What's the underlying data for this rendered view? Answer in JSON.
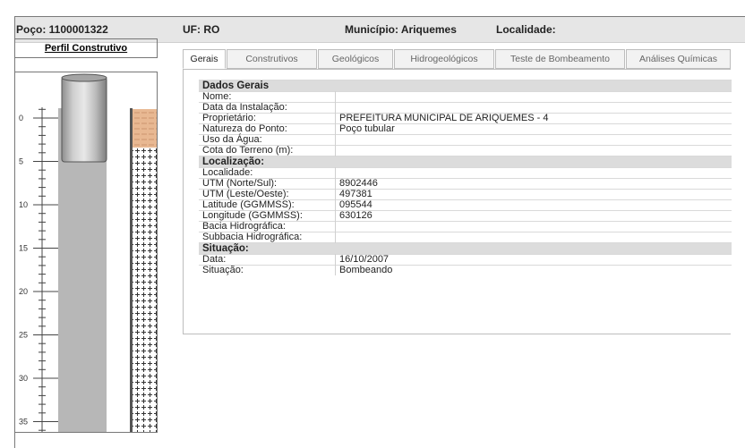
{
  "header": {
    "poco": "Poço: 1100001322",
    "uf": "UF: RO",
    "municipio": "Município: Ariquemes",
    "localidade": "Localidade:"
  },
  "left_panel": {
    "title": "Perfil Construtivo",
    "depth_labels": [
      "0",
      "5",
      "10",
      "15",
      "20",
      "25",
      "30",
      "35"
    ]
  },
  "tabs": [
    {
      "label": "Gerais",
      "active": true
    },
    {
      "label": "Construtivos",
      "active": false
    },
    {
      "label": "Geológicos",
      "active": false
    },
    {
      "label": "Hidrogeológicos",
      "active": false
    },
    {
      "label": "Teste de Bombeamento",
      "active": false
    },
    {
      "label": "Análises Químicas",
      "active": false
    }
  ],
  "sections": [
    {
      "title": "Dados Gerais",
      "rows": [
        {
          "label": "Nome:",
          "value": ""
        },
        {
          "label": "Data da Instalação:",
          "value": ""
        },
        {
          "label": "Proprietário:",
          "value": "PREFEITURA MUNICIPAL DE ARIQUEMES - 4"
        },
        {
          "label": "Natureza do Ponto:",
          "value": "Poço tubular"
        },
        {
          "label": "Uso da Água:",
          "value": ""
        },
        {
          "label": "Cota do Terreno (m):",
          "value": ""
        }
      ]
    },
    {
      "title": "Localização:",
      "rows": [
        {
          "label": "Localidade:",
          "value": ""
        },
        {
          "label": "UTM (Norte/Sul):",
          "value": "8902446"
        },
        {
          "label": "UTM (Leste/Oeste):",
          "value": "497381"
        },
        {
          "label": "Latitude (GGMMSS):",
          "value": "095544"
        },
        {
          "label": "Longitude (GGMMSS):",
          "value": "630126"
        },
        {
          "label": "Bacia Hidrográfica:",
          "value": ""
        },
        {
          "label": "Subbacia Hidrográfica:",
          "value": ""
        }
      ]
    },
    {
      "title": "Situação:",
      "rows": [
        {
          "label": "Data:",
          "value": "16/10/2007"
        },
        {
          "label": "Situação:",
          "value": "Bombeando"
        }
      ]
    }
  ]
}
